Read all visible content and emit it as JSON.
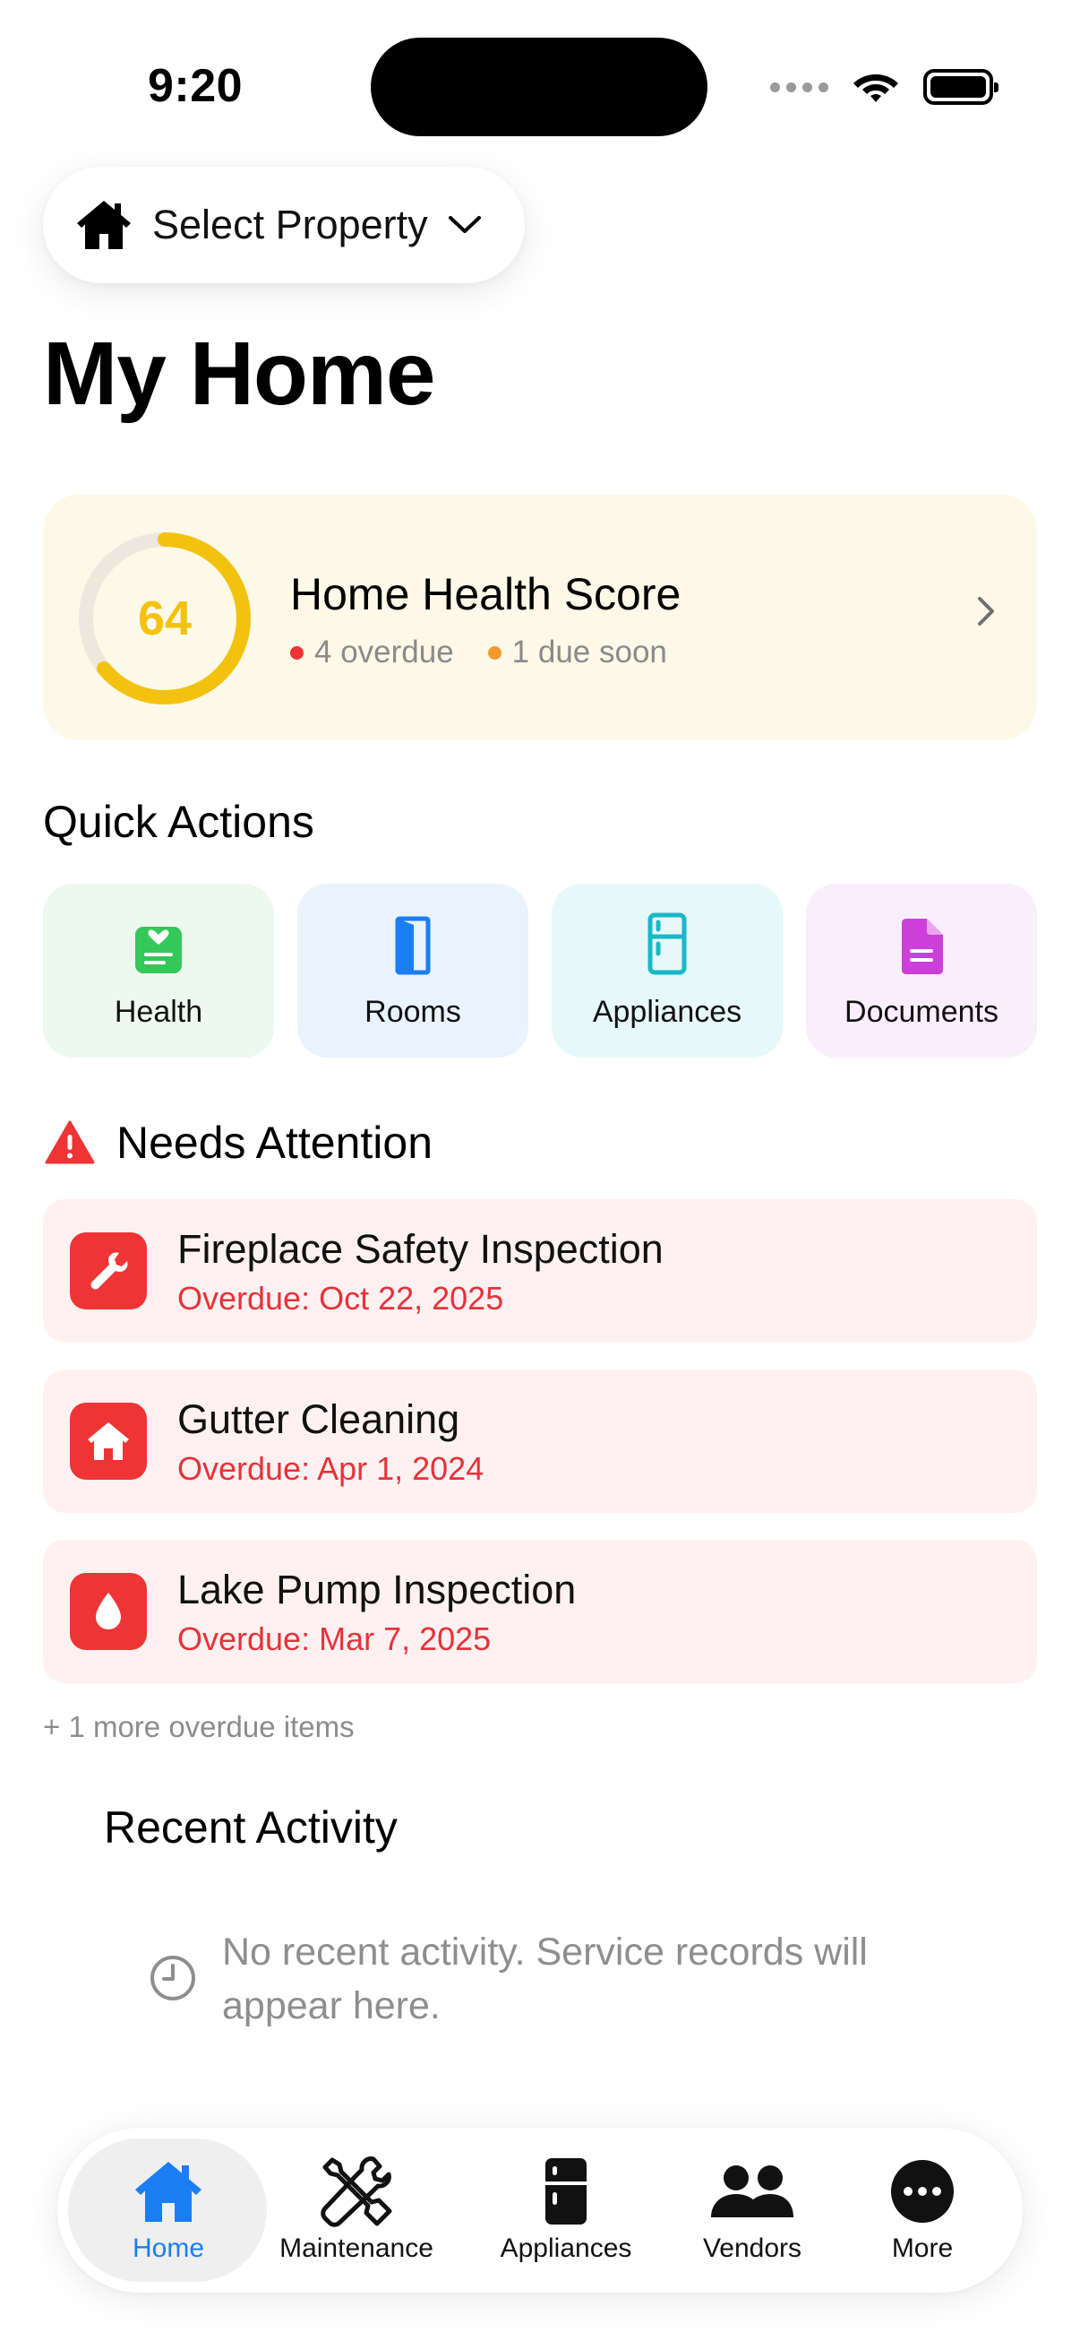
{
  "status_bar": {
    "time": "9:20"
  },
  "header": {
    "property_select_label": "Select Property",
    "title": "My Home"
  },
  "health": {
    "score": "64",
    "score_fraction": 0.64,
    "title": "Home Health Score",
    "overdue_text": "4 overdue",
    "due_soon_text": "1 due soon",
    "colors": {
      "ring": "#f3c20e",
      "overdue_dot": "#ee3434",
      "due_soon_dot": "#f19a2a",
      "card_bg": "#fdf9e8"
    }
  },
  "quick_actions": {
    "title": "Quick Actions",
    "items": [
      {
        "label": "Health",
        "icon": "health-card-icon",
        "bg": "#edf8ee",
        "color": "#34c759"
      },
      {
        "label": "Rooms",
        "icon": "door-icon",
        "bg": "#e9f3fe",
        "color": "#1a7ef5"
      },
      {
        "label": "Appliances",
        "icon": "fridge-icon",
        "bg": "#e6f8f8",
        "color": "#18b9c6"
      },
      {
        "label": "Documents",
        "icon": "document-icon",
        "bg": "#fbeefc",
        "color": "#cc3fd8"
      }
    ]
  },
  "attention": {
    "title": "Needs Attention",
    "items": [
      {
        "title": "Fireplace Safety Inspection",
        "date": "Overdue: Oct 22, 2025",
        "icon": "wrench-icon"
      },
      {
        "title": "Gutter Cleaning",
        "date": "Overdue: Apr 1, 2024",
        "icon": "house-icon"
      },
      {
        "title": "Lake Pump Inspection",
        "date": "Overdue: Mar 7, 2025",
        "icon": "water-drop-icon"
      }
    ],
    "more_text": "+ 1 more overdue items"
  },
  "recent": {
    "title": "Recent Activity",
    "empty_text": "No recent activity. Service records will appear here."
  },
  "tabs": [
    {
      "label": "Home",
      "icon": "house-icon",
      "active": true
    },
    {
      "label": "Maintenance",
      "icon": "tools-icon",
      "active": false
    },
    {
      "label": "Appliances",
      "icon": "fridge-icon",
      "active": false
    },
    {
      "label": "Vendors",
      "icon": "people-icon",
      "active": false
    },
    {
      "label": "More",
      "icon": "more-icon",
      "active": false
    }
  ],
  "accent_color": "#1a7ef5"
}
